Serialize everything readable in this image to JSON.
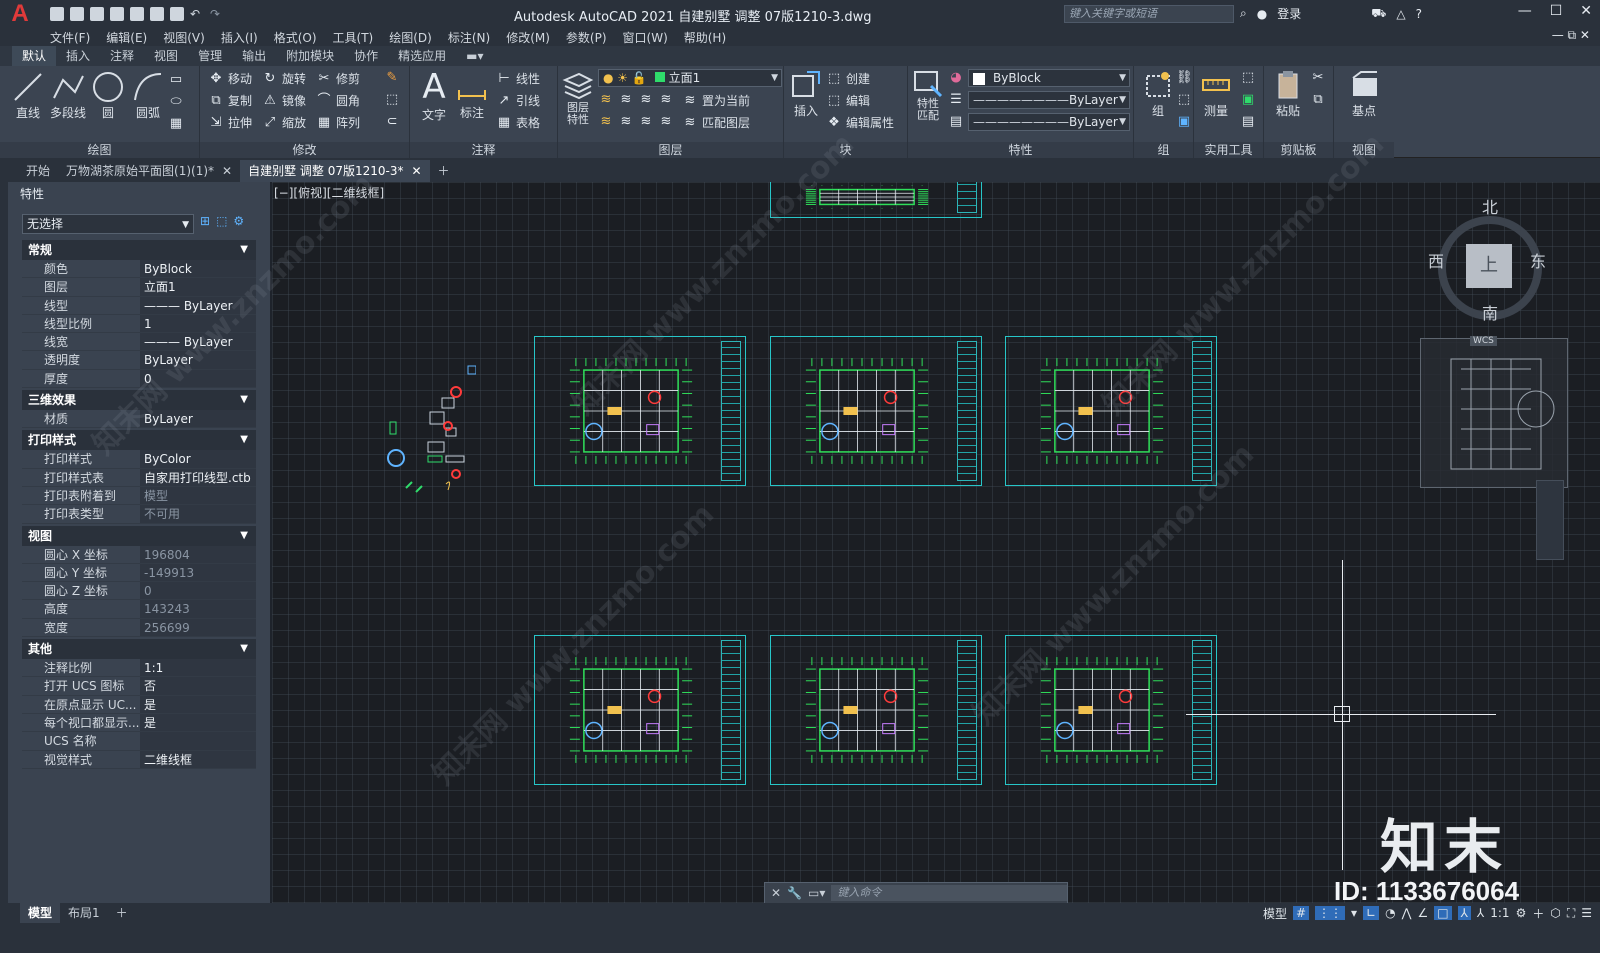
{
  "title": "Autodesk AutoCAD 2021    自建别墅 调整 07版1210-3.dwg",
  "search_placeholder": "键入关键字或短语",
  "login": "登录",
  "menu": [
    "文件(F)",
    "编辑(E)",
    "视图(V)",
    "插入(I)",
    "格式(O)",
    "工具(T)",
    "绘图(D)",
    "标注(N)",
    "修改(M)",
    "参数(P)",
    "窗口(W)",
    "帮助(H)"
  ],
  "ribbon_tabs": [
    "默认",
    "插入",
    "注释",
    "视图",
    "管理",
    "输出",
    "附加模块",
    "协作",
    "精选应用"
  ],
  "draw_panel": {
    "line": "直线",
    "polyline": "多段线",
    "circle": "圆",
    "arc": "圆弧",
    "title": "绘图"
  },
  "modify_panel": {
    "move": "移动",
    "rotate": "旋转",
    "trim": "修剪",
    "copy": "复制",
    "mirror": "镜像",
    "fillet": "圆角",
    "stretch": "拉伸",
    "scale": "缩放",
    "array": "阵列",
    "title": "修改"
  },
  "annotation_panel": {
    "text": "文字",
    "dim": "标注",
    "linear": "线性",
    "leader": "引线",
    "table": "表格",
    "title": "注释"
  },
  "layer_panel": {
    "props": "图层\n特性",
    "current_layer": "立面1",
    "set_current": "置为当前",
    "match_layer": "匹配图层",
    "title": "图层"
  },
  "block_panel": {
    "insert": "插入",
    "create": "创建",
    "edit": "编辑",
    "edit_attr": "编辑属性",
    "title": "块"
  },
  "properties_panel": {
    "match": "特性\n匹配",
    "color": "ByBlock",
    "linetype": "ByLayer",
    "lineweight": "ByLayer",
    "title": "特性"
  },
  "group_panel": {
    "group": "组",
    "title": "组"
  },
  "util_panel": {
    "measure": "测量",
    "title": "实用工具"
  },
  "clip_panel": {
    "paste": "粘贴",
    "title": "剪贴板"
  },
  "view_panel": {
    "base": "基点",
    "title": "视图"
  },
  "doc_tabs": [
    "开始",
    "万物湖茶原始平面图(1)(1)*",
    "自建别墅 调整 07版1210-3*"
  ],
  "props": {
    "header": "特性",
    "selection": "无选择",
    "sections": [
      {
        "name": "常规",
        "rows": [
          [
            "颜色",
            "ByBlock"
          ],
          [
            "图层",
            "立面1"
          ],
          [
            "线型",
            "——— ByLayer"
          ],
          [
            "线型比例",
            "1"
          ],
          [
            "线宽",
            "——— ByLayer"
          ],
          [
            "透明度",
            "ByLayer"
          ],
          [
            "厚度",
            "0"
          ]
        ]
      },
      {
        "name": "三维效果",
        "rows": [
          [
            "材质",
            "ByLayer"
          ]
        ]
      },
      {
        "name": "打印样式",
        "rows": [
          [
            "打印样式",
            "ByColor"
          ],
          [
            "打印样式表",
            "自家用打印线型.ctb"
          ],
          [
            "打印表附着到",
            "模型"
          ],
          [
            "打印表类型",
            "不可用"
          ]
        ]
      },
      {
        "name": "视图",
        "rows": [
          [
            "圆心 X 坐标",
            "196804"
          ],
          [
            "圆心 Y 坐标",
            "-149913"
          ],
          [
            "圆心 Z 坐标",
            "0"
          ],
          [
            "高度",
            "143243"
          ],
          [
            "宽度",
            "256699"
          ]
        ]
      },
      {
        "name": "其他",
        "rows": [
          [
            "注释比例",
            "1:1"
          ],
          [
            "打开 UCS 图标",
            "否"
          ],
          [
            "在原点显示 UC...",
            "是"
          ],
          [
            "每个视口都显示...",
            "是"
          ],
          [
            "UCS 名称",
            ""
          ],
          [
            "视觉样式",
            "二维线框"
          ]
        ]
      }
    ]
  },
  "viewport_label": "[−][俯视][二维线框]",
  "viewcube": {
    "n": "北",
    "s": "南",
    "e": "东",
    "w": "西",
    "face": "上",
    "wcs": "WCS"
  },
  "cmd_placeholder": "键入命令",
  "layout_tabs": [
    "模型",
    "布局1"
  ],
  "status": {
    "model": "模型",
    "scale": "1:1"
  },
  "watermark_brand": "知末",
  "watermark_id": "ID: 1133676064",
  "watermark_text": "知末网 www.znzmo.com"
}
